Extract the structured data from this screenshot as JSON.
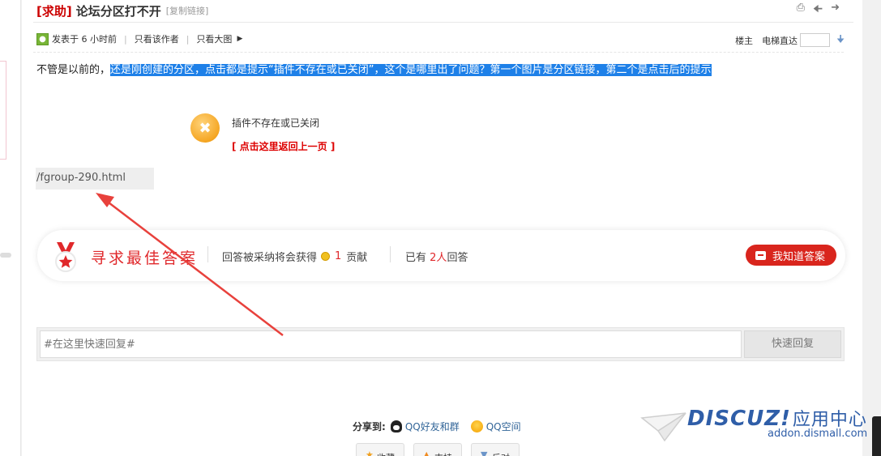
{
  "thread": {
    "tag_open": "[",
    "tag": "求助",
    "tag_close": "]",
    "title": "论坛分区打不开",
    "copy_link": "[复制链接]"
  },
  "meta": {
    "posted": "发表于 6 小时前",
    "author_only": "只看该作者",
    "large_image": "只看大图",
    "floor": "楼主",
    "elevator": "电梯直达"
  },
  "post": {
    "text_plain": "不管是以前的，",
    "text_selected": "还是刚创建的分区，点击都是提示“插件不存在或已关闭”，这个是哪里出了问题？第一个图片是分区链接，第二个是点击后的提示"
  },
  "error_box": {
    "message": "插件不存在或已关闭",
    "back_link": "[ 点击这里返回上一页 ]"
  },
  "url_chip": {
    "text": "/fgroup-290.html"
  },
  "answer": {
    "title": "寻求最佳答案",
    "reward_prefix": "回答被采纳将会获得",
    "reward_amount": "1",
    "reward_unit": "贡献",
    "count_prefix": "已有",
    "count": "2人",
    "count_suffix": "回答",
    "button": "我知道答案"
  },
  "reply": {
    "placeholder": "#在这里快速回复#",
    "button": "快速回复"
  },
  "share": {
    "label": "分享到:",
    "qq_friends": "QQ好友和群",
    "qzone": "QQ空间"
  },
  "bottom_buttons": [
    "收藏",
    "支持",
    "反对"
  ],
  "watermark": {
    "brand": "DISCUZ!",
    "brand_cn": "应用中心",
    "url": "addon.dismall.com"
  },
  "icons": {
    "print": "print-icon",
    "prev": "arrow-left-icon",
    "next": "arrow-right-icon",
    "jump": "arrow-down-icon",
    "error": "close-circle-icon"
  },
  "colors": {
    "accent_red": "#e0282b",
    "selection_blue": "#1e80e8",
    "link_blue": "#336699",
    "annotation_arrow": "#e8413c"
  }
}
